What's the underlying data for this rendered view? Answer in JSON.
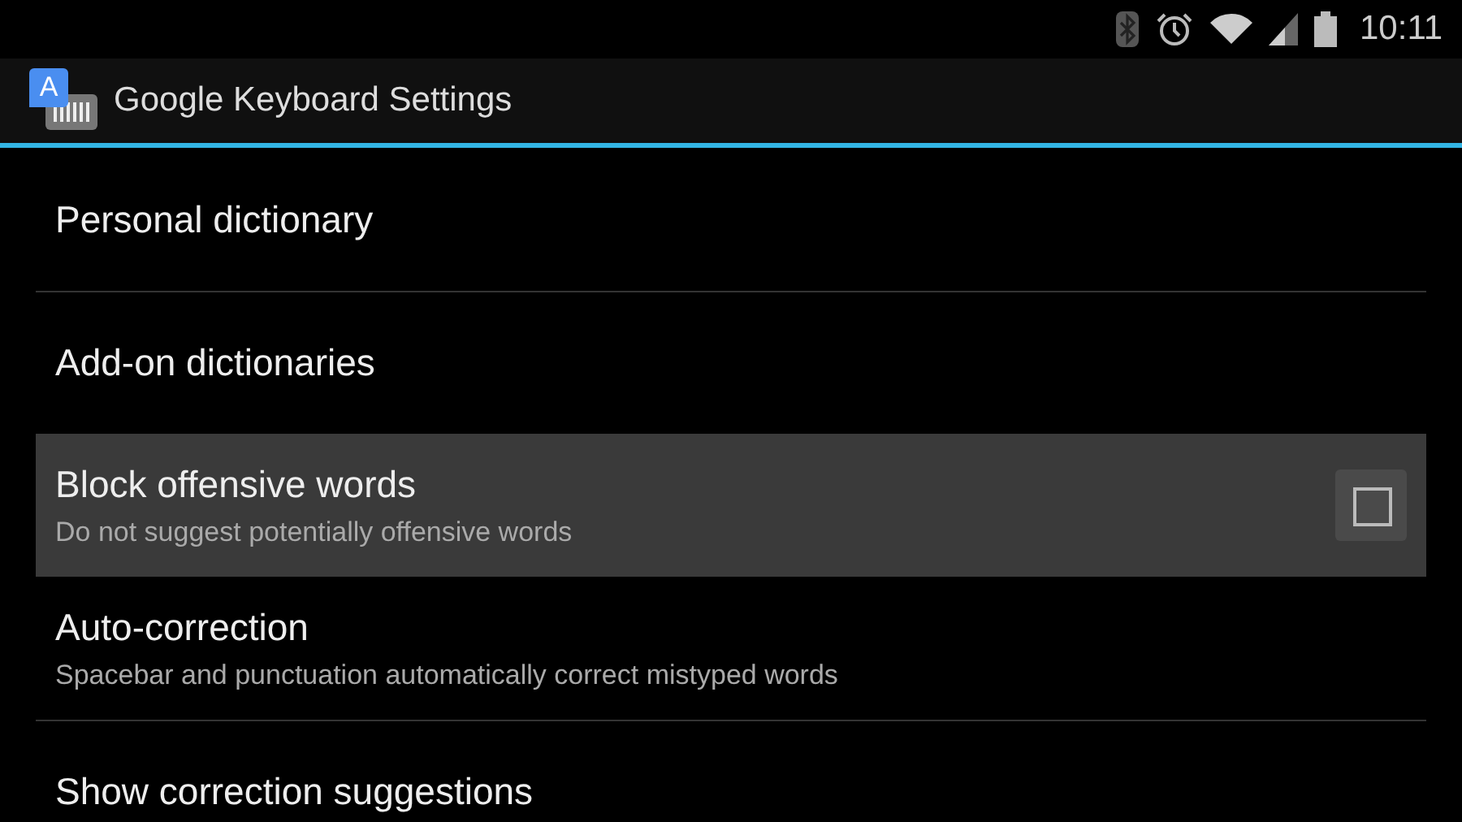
{
  "status_bar": {
    "time": "10:11"
  },
  "action_bar": {
    "app_icon_letter": "A",
    "title": "Google Keyboard Settings"
  },
  "items": [
    {
      "kind": "plain",
      "title": "Personal dictionary",
      "pressed": false
    },
    {
      "kind": "plain",
      "title": "Add-on dictionaries",
      "pressed": false
    },
    {
      "kind": "checkbox",
      "title": "Block offensive words",
      "summary": "Do not suggest potentially offensive words",
      "pressed": true,
      "checked": false
    },
    {
      "kind": "plain",
      "title": "Auto-correction",
      "summary": "Spacebar and punctuation automatically correct mistyped words",
      "pressed": false
    },
    {
      "kind": "plain",
      "title": "Show correction suggestions",
      "pressed": false
    }
  ]
}
